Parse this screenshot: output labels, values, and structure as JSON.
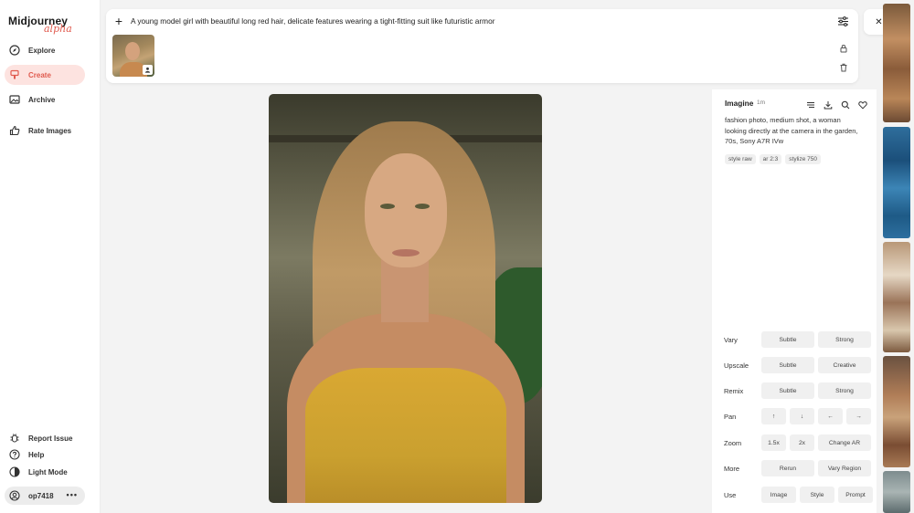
{
  "sidebar": {
    "logo_text": "Midjourney",
    "logo_sub": "alpha",
    "nav": [
      {
        "label": "Explore",
        "icon": "compass-icon"
      },
      {
        "label": "Create",
        "icon": "brush-icon",
        "active": true
      },
      {
        "label": "Archive",
        "icon": "image-icon"
      },
      {
        "label": "Rate Images",
        "icon": "thumbs-up-icon"
      }
    ],
    "bottom": [
      {
        "label": "Report Issue",
        "icon": "bug-icon"
      },
      {
        "label": "Help",
        "icon": "help-icon"
      },
      {
        "label": "Light Mode",
        "icon": "sun-icon"
      }
    ],
    "user": {
      "name": "op7418",
      "menu": "•••"
    }
  },
  "prompt_bar": {
    "plus": "+",
    "text": "A young model girl with beautiful long red hair, delicate features wearing a tight-fitting suit like futuristic armor"
  },
  "close": "✕",
  "info": {
    "title": "Imagine",
    "time": "1m",
    "prompt": "fashion photo, medium shot, a woman looking directly at the camera in the garden, 70s, Sony A7R IVw",
    "tags": [
      "style raw",
      "ar 2:3",
      "stylize 750"
    ]
  },
  "actions": [
    {
      "label": "Vary",
      "buttons": [
        "Subtle",
        "Strong"
      ]
    },
    {
      "label": "Upscale",
      "buttons": [
        "Subtle",
        "Creative"
      ]
    },
    {
      "label": "Remix",
      "buttons": [
        "Subtle",
        "Strong"
      ]
    },
    {
      "label": "Pan",
      "buttons": [
        "↑",
        "↓",
        "←",
        "→"
      ]
    },
    {
      "label": "Zoom",
      "buttons": [
        "1.5x",
        "2x",
        "Change AR"
      ]
    },
    {
      "label": "More",
      "buttons": [
        "Rerun",
        "Vary Region"
      ]
    },
    {
      "label": "Use",
      "buttons": [
        "Image",
        "Style",
        "Prompt"
      ]
    }
  ],
  "colors": {
    "accent": "#e05a4e",
    "active_bg": "#fde3e0",
    "panel_bg": "#ffffff",
    "page_bg": "#f3f3f3"
  }
}
